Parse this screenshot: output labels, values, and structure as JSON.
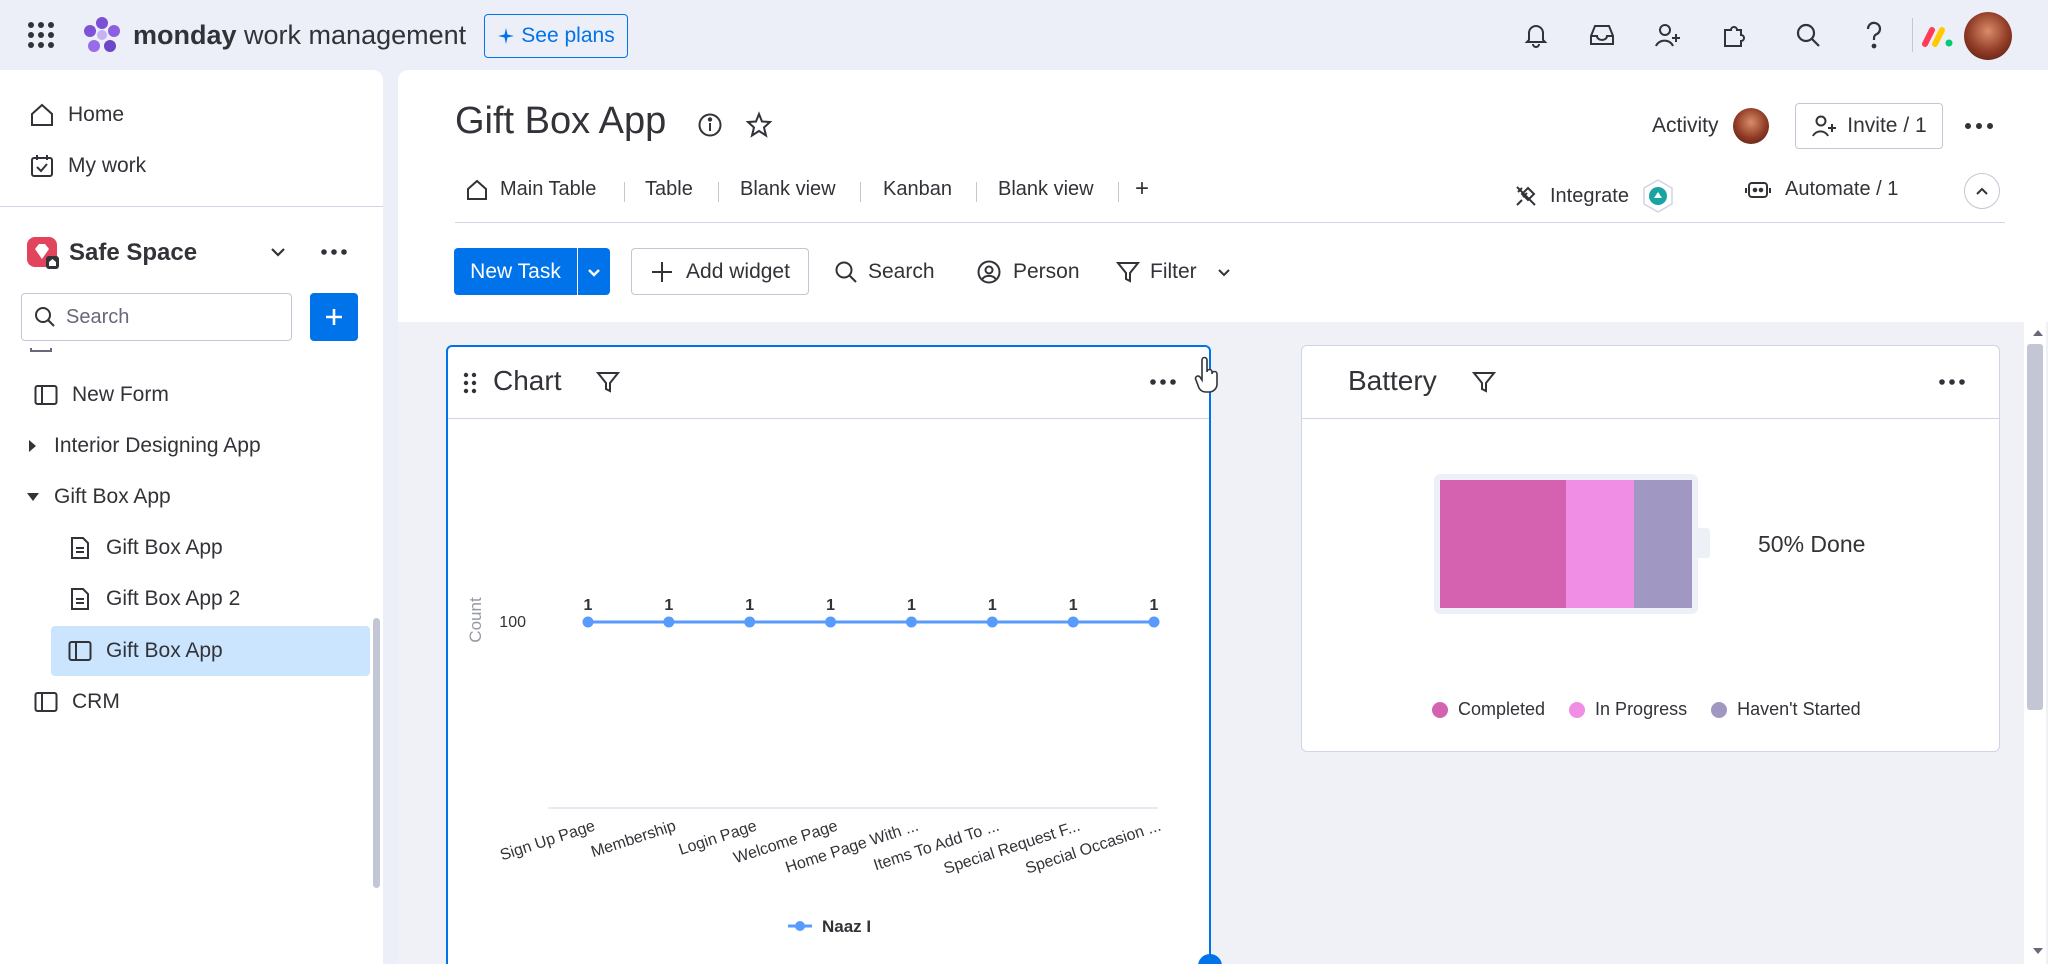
{
  "topbar": {
    "brand_bold": "monday",
    "brand_rest": " work management",
    "see_plans": "See plans"
  },
  "sidebar": {
    "home": "Home",
    "my_work": "My work",
    "workspace": "Safe Space",
    "search_placeholder": "Search",
    "items": [
      {
        "label": "New Form",
        "icon": "board-icon"
      },
      {
        "label": "Interior Designing App",
        "icon": "caret-right-icon"
      },
      {
        "label": "Gift Box App",
        "icon": "caret-down-icon"
      },
      {
        "label": "Gift Box App",
        "icon": "doc-icon"
      },
      {
        "label": "Gift Box App 2",
        "icon": "doc-icon"
      },
      {
        "label": "Gift Box App",
        "icon": "board-icon",
        "selected": true
      },
      {
        "label": "CRM",
        "icon": "board-icon"
      }
    ]
  },
  "board": {
    "title": "Gift Box App",
    "activity": "Activity",
    "invite": "Invite / 1",
    "tabs": [
      "Main Table",
      "Table",
      "Blank view",
      "Kanban",
      "Blank view"
    ],
    "add_tab": "+",
    "integrate": "Integrate",
    "automate": "Automate / 1"
  },
  "toolbar": {
    "new_task": "New Task",
    "add_widget": "Add widget",
    "search": "Search",
    "person": "Person",
    "filter": "Filter"
  },
  "chart_widget": {
    "title": "Chart"
  },
  "battery_widget": {
    "title": "Battery",
    "status": "50% Done",
    "segments": [
      {
        "label": "Completed",
        "color": "#d462b1",
        "fraction": 0.5
      },
      {
        "label": "In Progress",
        "color": "#f08de4",
        "fraction": 0.27
      },
      {
        "label": "Haven't Started",
        "color": "#a098c2",
        "fraction": 0.23
      }
    ]
  },
  "colors": {
    "primary": "#0073ea",
    "line": "#579bfc",
    "selected_bg": "#cce5ff"
  },
  "chart_data": {
    "type": "line",
    "ylabel": "Count",
    "ytick": "100",
    "categories": [
      "Sign Up Page",
      "Membership",
      "Login Page",
      "Welcome Page",
      "Home Page With ...",
      "Items To Add To ...",
      "Special Request F...",
      "Special Occasion ..."
    ],
    "series": [
      {
        "name": "Naaz I",
        "values": [
          1,
          1,
          1,
          1,
          1,
          1,
          1,
          1
        ]
      }
    ]
  }
}
